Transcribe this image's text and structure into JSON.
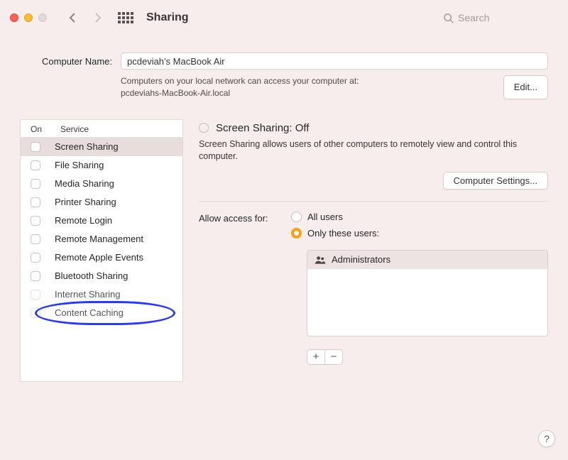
{
  "toolbar": {
    "title": "Sharing",
    "search_placeholder": "Search"
  },
  "computer": {
    "label": "Computer Name:",
    "name": "pcdeviah's MacBook Air",
    "hint_line1": "Computers on your local network can access your computer at:",
    "hint_line2": "pcdeviahs-MacBook-Air.local",
    "edit_label": "Edit..."
  },
  "services": {
    "header_on": "On",
    "header_service": "Service",
    "items": [
      {
        "label": "Screen Sharing"
      },
      {
        "label": "File Sharing"
      },
      {
        "label": "Media Sharing"
      },
      {
        "label": "Printer Sharing"
      },
      {
        "label": "Remote Login"
      },
      {
        "label": "Remote Management"
      },
      {
        "label": "Remote Apple Events"
      },
      {
        "label": "Bluetooth Sharing"
      },
      {
        "label": "Internet Sharing"
      },
      {
        "label": "Content Caching"
      }
    ]
  },
  "detail": {
    "status_title": "Screen Sharing: Off",
    "description": "Screen Sharing allows users of other computers to remotely view and control this computer.",
    "computer_settings_label": "Computer Settings...",
    "access_label": "Allow access for:",
    "all_users_label": "All users",
    "only_users_label": "Only these users:",
    "admins_label": "Administrators",
    "plus": "+",
    "minus": "−"
  },
  "help": {
    "label": "?"
  }
}
